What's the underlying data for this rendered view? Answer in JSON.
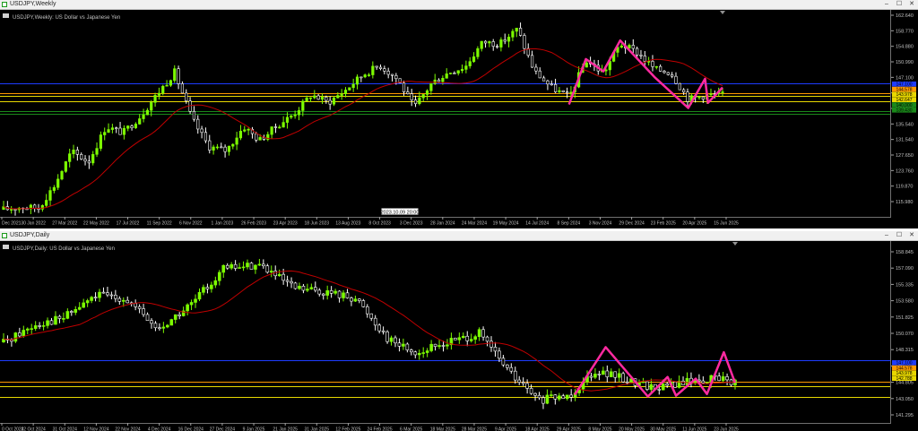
{
  "windows": [
    {
      "title": "USDJPY,Weekly",
      "subtitle": "USDJPY,Weekly:  US Dollar vs Japanese Yen",
      "yaxis_ticks": [
        "162.640",
        "158.770",
        "154.880",
        "150.990",
        "147.100",
        "143.210",
        "139.430",
        "135.540",
        "131.540",
        "127.650",
        "123.760",
        "119.870",
        "115.980"
      ],
      "xaxis_ticks": [
        "Dec 2021",
        "30 Jan 2022",
        "27 Mar 2022",
        "22 May 2022",
        "17 Jul 2022",
        "11 Sep 2022",
        "6 Nov 2022",
        "1 Jan 2023",
        "26 Feb 2023",
        "23 Apr 2023",
        "18 Jun 2023",
        "13 Aug 2023",
        "8 Oct 2023",
        "3 Dec 2023",
        "28 Jan 2024",
        "24 Mar 2024",
        "19 May 2024",
        "14 Jul 2024",
        "8 Sep 2024",
        "3 Nov 2024",
        "29 Dec 2024",
        "23 Feb 2025",
        "20 Apr 2025",
        "15 Jun 2025"
      ],
      "crosshair_label": "2023.10.09 20:00",
      "price_labels": [
        {
          "value": "147.100",
          "color": "#1e3cff"
        },
        {
          "value": "144.578",
          "color": "#ff9900"
        },
        {
          "value": "143.978",
          "color": "#e8d800"
        },
        {
          "value": "142.647",
          "color": "#e8d800"
        },
        {
          "value": "140.000",
          "color": "#1a8a1a"
        },
        {
          "value": "139.430",
          "color": "#1a8a1a"
        }
      ]
    },
    {
      "title": "USDJPY,Daily",
      "subtitle": "USDJPY,Daily:  US Dollar vs Japanese Yen",
      "yaxis_ticks": [
        "158.845",
        "157.090",
        "155.335",
        "153.580",
        "151.825",
        "150.070",
        "148.315",
        "146.560",
        "144.805",
        "143.050",
        "141.295"
      ],
      "xaxis_ticks": [
        "0 Oct 2024",
        "22 Oct 2024",
        "31 Oct 2024",
        "12 Nov 2024",
        "22 Nov 2024",
        "4 Dec 2024",
        "16 Dec 2024",
        "27 Dec 2024",
        "9 Jan 2025",
        "21 Jan 2025",
        "31 Jan 2025",
        "12 Feb 2025",
        "24 Feb 2025",
        "6 Mar 2025",
        "18 Mar 2025",
        "28 Mar 2025",
        "9 Apr 2025",
        "18 Apr 2025",
        "29 Apr 2025",
        "8 May 2025",
        "20 May 2025",
        "30 May 2025",
        "11 Jun 2025",
        "23 Jun 2025"
      ],
      "price_labels": [
        {
          "value": "147.100",
          "color": "#1e3cff"
        },
        {
          "value": "144.578",
          "color": "#ff9900"
        },
        {
          "value": "143.978",
          "color": "#e8d800"
        },
        {
          "value": "142.788",
          "color": "#e8d800"
        }
      ]
    }
  ],
  "colors": {
    "background": "#000000",
    "bull_candle": "#7dfc00",
    "bear_candle": "#ffffff",
    "moving_average": "#c00000",
    "zigzag": "#ff2aa0",
    "support_blue": "#1e3cff",
    "support_yellow": "#e8d800",
    "support_orange": "#ff9900",
    "support_green": "#1a8a1a",
    "axis_text": "#c0c0c0"
  },
  "window_buttons": [
    "–",
    "☐",
    "✕"
  ],
  "chart_data": [
    {
      "type": "candlestick",
      "title": "USDJPY,Weekly:  US Dollar vs Japanese Yen",
      "ylim": [
        114.0,
        163.5
      ],
      "levels": [
        {
          "price": 147.1,
          "kind": "blue"
        },
        {
          "price": 144.578,
          "kind": "orange"
        },
        {
          "price": 143.978,
          "kind": "yellow"
        },
        {
          "price": 142.647,
          "kind": "yellow"
        },
        {
          "price": 140.0,
          "kind": "green"
        },
        {
          "price": 139.43,
          "kind": "green"
        }
      ],
      "path_points": [
        [
          "2021-12",
          115.2
        ],
        [
          "2022-01",
          115.8
        ],
        [
          "2022-02",
          115.5
        ],
        [
          "2022-03",
          121.2
        ],
        [
          "2022-04",
          129.9
        ],
        [
          "2022-05",
          127.2
        ],
        [
          "2022-06",
          136.2
        ],
        [
          "2022-07",
          134.6
        ],
        [
          "2022-08",
          138.8
        ],
        [
          "2022-09",
          144.6
        ],
        [
          "2022-10",
          150.0
        ],
        [
          "2022-11",
          138.1
        ],
        [
          "2022-12",
          131.1
        ],
        [
          "2023-01",
          130.1
        ],
        [
          "2023-02",
          136.2
        ],
        [
          "2023-03",
          132.7
        ],
        [
          "2023-04",
          136.4
        ],
        [
          "2023-05",
          139.4
        ],
        [
          "2023-06",
          144.3
        ],
        [
          "2023-07",
          142.3
        ],
        [
          "2023-08",
          145.5
        ],
        [
          "2023-09",
          149.4
        ],
        [
          "2023-10",
          151.7
        ],
        [
          "2023-11",
          148.2
        ],
        [
          "2023-12",
          141.0
        ],
        [
          "2024-01",
          147.2
        ],
        [
          "2024-02",
          150.0
        ],
        [
          "2024-03",
          151.4
        ],
        [
          "2024-04",
          157.7
        ],
        [
          "2024-05",
          157.1
        ],
        [
          "2024-06",
          160.9
        ],
        [
          "2024-07",
          150.3
        ],
        [
          "2024-08",
          146.1
        ],
        [
          "2024-09",
          143.6
        ],
        [
          "2024-10",
          153.0
        ],
        [
          "2024-11",
          149.8
        ],
        [
          "2024-12",
          157.2
        ],
        [
          "2025-01",
          154.9
        ],
        [
          "2025-02",
          150.7
        ],
        [
          "2025-03",
          149.9
        ],
        [
          "2025-04",
          143.1
        ],
        [
          "2025-05",
          144.1
        ],
        [
          "2025-06",
          144.4
        ]
      ],
      "zigzag": [
        [
          "2024-09",
          141.8
        ],
        [
          "2024-10",
          153.3
        ],
        [
          "2024-11",
          150.2
        ],
        [
          "2024-12",
          158.0
        ],
        [
          "2025-02",
          148.6
        ],
        [
          "2025-04",
          140.9
        ],
        [
          "2025-05",
          148.3
        ],
        [
          "2025-05-20",
          142.2
        ],
        [
          "2025-06",
          146.1
        ]
      ],
      "ma_period": "weekly"
    },
    {
      "type": "candlestick",
      "title": "USDJPY,Daily:  US Dollar vs Japanese Yen",
      "ylim": [
        139.8,
        159.8
      ],
      "levels": [
        {
          "price": 147.1,
          "kind": "blue"
        },
        {
          "price": 144.578,
          "kind": "orange"
        },
        {
          "price": 143.978,
          "kind": "yellow"
        },
        {
          "price": 142.788,
          "kind": "yellow"
        }
      ],
      "path_points": [
        [
          "2024-10-10",
          149.2
        ],
        [
          "2024-10-22",
          151.4
        ],
        [
          "2024-10-31",
          152.0
        ],
        [
          "2024-11-12",
          154.7
        ],
        [
          "2024-11-22",
          154.4
        ],
        [
          "2024-12-04",
          150.6
        ],
        [
          "2024-12-16",
          153.7
        ],
        [
          "2024-12-27",
          157.8
        ],
        [
          "2025-01-09",
          158.3
        ],
        [
          "2025-01-21",
          155.5
        ],
        [
          "2025-01-31",
          155.1
        ],
        [
          "2025-02-12",
          154.4
        ],
        [
          "2025-02-24",
          149.5
        ],
        [
          "2025-03-06",
          147.9
        ],
        [
          "2025-03-18",
          149.3
        ],
        [
          "2025-03-28",
          150.2
        ],
        [
          "2025-04-09",
          145.2
        ],
        [
          "2025-04-18",
          142.3
        ],
        [
          "2025-04-29",
          142.9
        ],
        [
          "2025-05-08",
          145.9
        ],
        [
          "2025-05-20",
          144.7
        ],
        [
          "2025-05-30",
          143.8
        ],
        [
          "2025-06-11",
          144.6
        ],
        [
          "2025-06-23",
          145.0
        ],
        [
          "2025-06-27",
          144.4
        ]
      ],
      "zigzag": [
        [
          "2025-05-01",
          143.0
        ],
        [
          "2025-05-12",
          148.6
        ],
        [
          "2025-05-27",
          142.8
        ],
        [
          "2025-06-03",
          145.1
        ],
        [
          "2025-06-06",
          142.9
        ],
        [
          "2025-06-13",
          144.9
        ],
        [
          "2025-06-17",
          143.1
        ],
        [
          "2025-06-23",
          148.0
        ],
        [
          "2025-06-27",
          144.4
        ]
      ],
      "ma_period": "daily"
    }
  ]
}
